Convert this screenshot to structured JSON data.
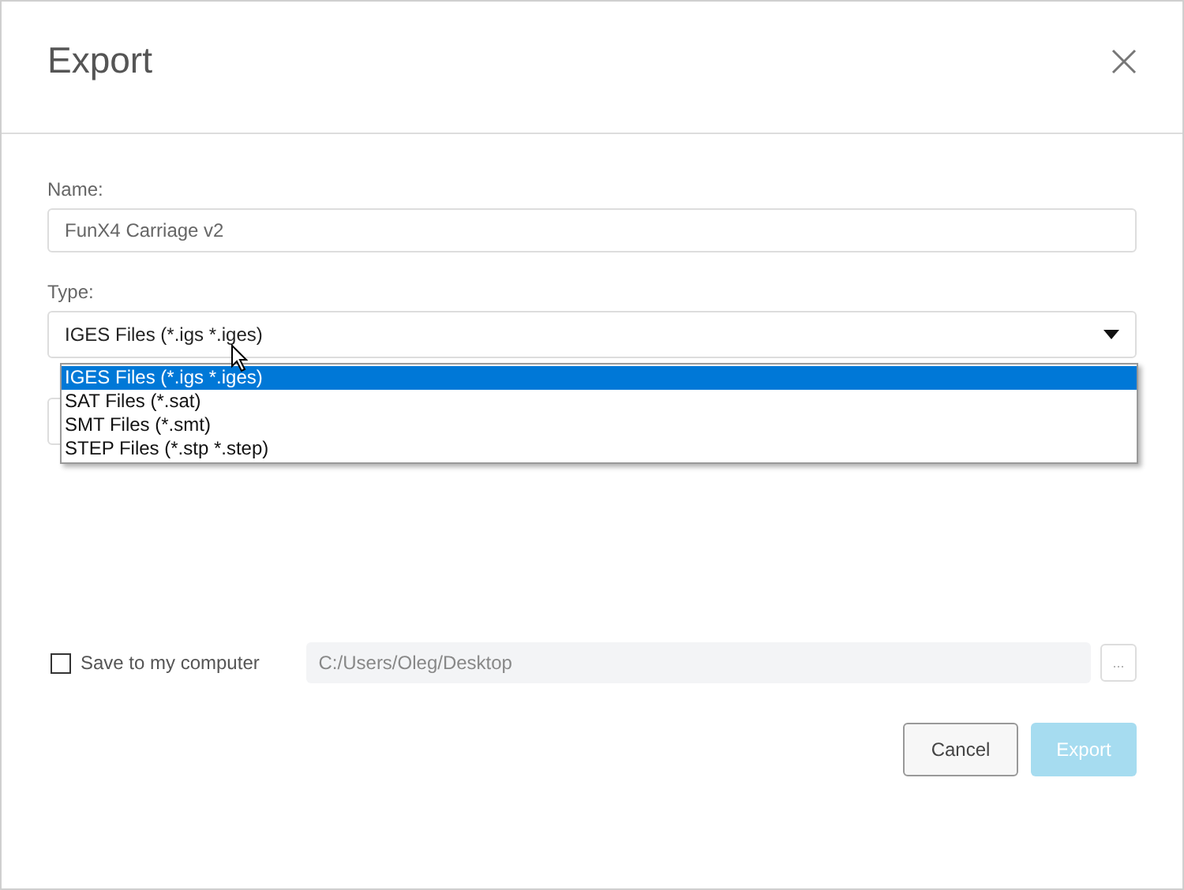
{
  "dialog": {
    "title": "Export"
  },
  "name_field": {
    "label": "Name:",
    "value": "FunX4 Carriage v2"
  },
  "type_field": {
    "label": "Type:",
    "value": "IGES Files (*.igs *.iges)",
    "expanded": true,
    "options": [
      {
        "label": "IGES Files (*.igs *.iges)",
        "selected": true
      },
      {
        "label": "SAT Files (*.sat)",
        "selected": false
      },
      {
        "label": "SMT Files (*.smt)",
        "selected": false
      },
      {
        "label": "STEP Files (*.stp *.step)",
        "selected": false
      }
    ]
  },
  "save_local": {
    "label": "Save to my computer",
    "checked": false,
    "path": "C:/Users/Oleg/Desktop",
    "browse": "..."
  },
  "buttons": [
    {
      "label": "Cancel",
      "kind": "secondary",
      "disabled": false
    },
    {
      "label": "Export",
      "kind": "primary",
      "disabled": true
    }
  ]
}
